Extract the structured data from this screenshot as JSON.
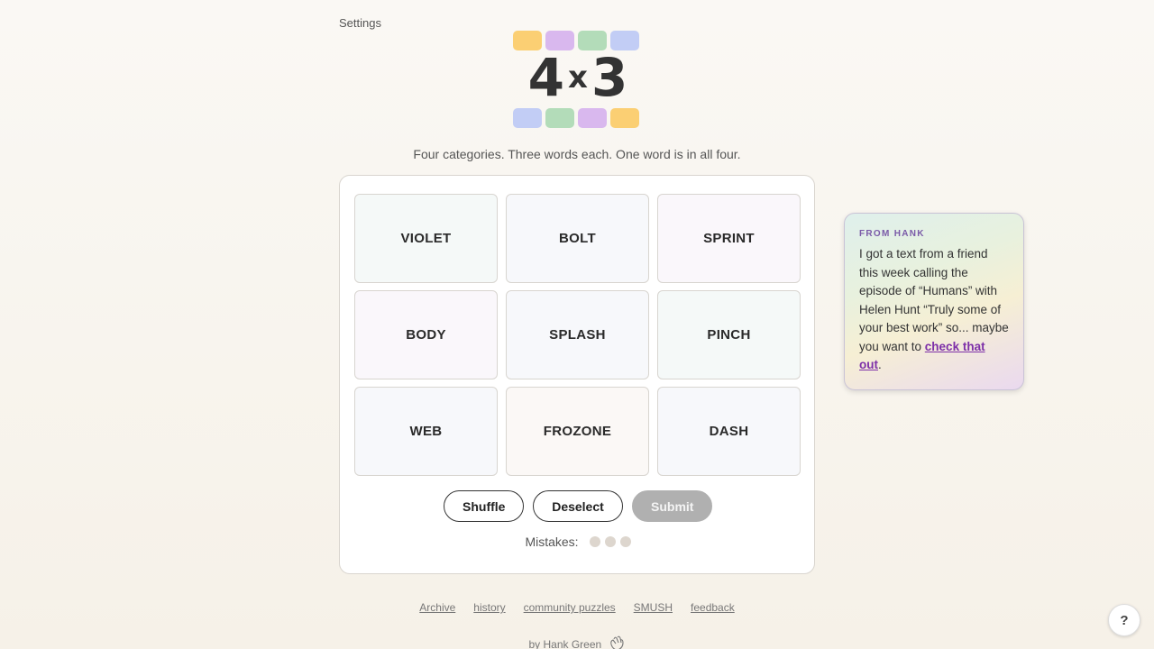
{
  "header": {
    "settings_label": "Settings"
  },
  "logo": {
    "text_left": "4",
    "text_mid": "x",
    "text_right": "3",
    "top_chips": [
      "#fbcf73",
      "#d9b8ee",
      "#b3dcb9",
      "#c2cdf5"
    ],
    "bottom_chips": [
      "#c2cdf5",
      "#b3dcb9",
      "#d9b8ee",
      "#fbcf73"
    ]
  },
  "subtitle": "Four categories. Three words each. One word is in all four.",
  "board": {
    "tiles": [
      {
        "label": "VIOLET",
        "bg": "#f5f9f8"
      },
      {
        "label": "BOLT",
        "bg": "#f7f8fb"
      },
      {
        "label": "SPRINT",
        "bg": "#faf7fb"
      },
      {
        "label": "BODY",
        "bg": "#faf7fb"
      },
      {
        "label": "SPLASH",
        "bg": "#f7f8fb"
      },
      {
        "label": "PINCH",
        "bg": "#f5f9f8"
      },
      {
        "label": "WEB",
        "bg": "#f7f8fb"
      },
      {
        "label": "FROZONE",
        "bg": "#fbf8f6"
      },
      {
        "label": "DASH",
        "bg": "#f7f8fb"
      }
    ],
    "shuffle_label": "Shuffle",
    "deselect_label": "Deselect",
    "submit_label": "Submit",
    "mistakes_label": "Mistakes:",
    "mistakes_remaining": 3
  },
  "note": {
    "title": "FROM HANK",
    "body_text": "I got a text from a friend this week calling the episode of “Humans” with Helen Hunt “Truly some of your best work” so... maybe you want to ",
    "link_text": "check that out",
    "body_end": "."
  },
  "footer": {
    "links": [
      "Archive",
      "history",
      "community puzzles",
      "SMUSH",
      "feedback"
    ],
    "byline": "by Hank Green"
  },
  "help_label": "?"
}
